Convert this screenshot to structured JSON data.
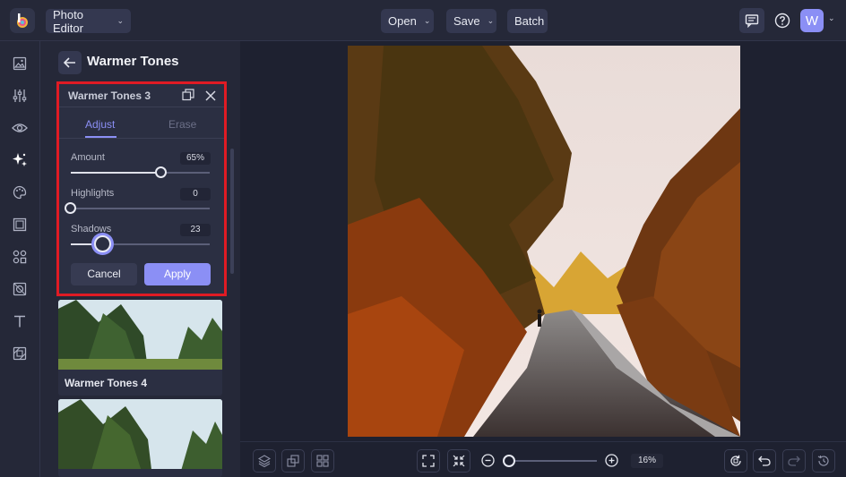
{
  "header": {
    "app_title": "Photo Editor",
    "menus": [
      {
        "label": "Open"
      },
      {
        "label": "Save"
      },
      {
        "label": "Batch"
      }
    ],
    "avatar_initial": "W"
  },
  "left_rail": {
    "icons": [
      "image-icon",
      "sliders-icon",
      "eye-icon",
      "magic-sparkle-icon",
      "palette-icon",
      "frame-icon",
      "shapes-icon",
      "texture-icon",
      "text-icon",
      "overlay-icon"
    ]
  },
  "panel": {
    "title": "Warmer Tones",
    "card": {
      "title": "Warmer Tones 3",
      "tabs": [
        {
          "label": "Adjust",
          "active": true
        },
        {
          "label": "Erase",
          "active": false
        }
      ],
      "sliders": [
        {
          "label": "Amount",
          "value": "65%",
          "level": 0.65
        },
        {
          "label": "Highlights",
          "value": "0",
          "level": 0.0
        },
        {
          "label": "Shadows",
          "value": "23",
          "level": 0.23
        }
      ],
      "cancel_label": "Cancel",
      "apply_label": "Apply"
    },
    "presets": [
      {
        "label": "Warmer Tones 4"
      },
      {
        "label": ""
      }
    ]
  },
  "bottom_bar": {
    "zoom_value": "16%",
    "zoom_level": 0.0
  },
  "colors": {
    "accent": "#8b8ff5",
    "highlight_border": "#e01b24",
    "background": "#1e2130",
    "panel": "#252838"
  }
}
